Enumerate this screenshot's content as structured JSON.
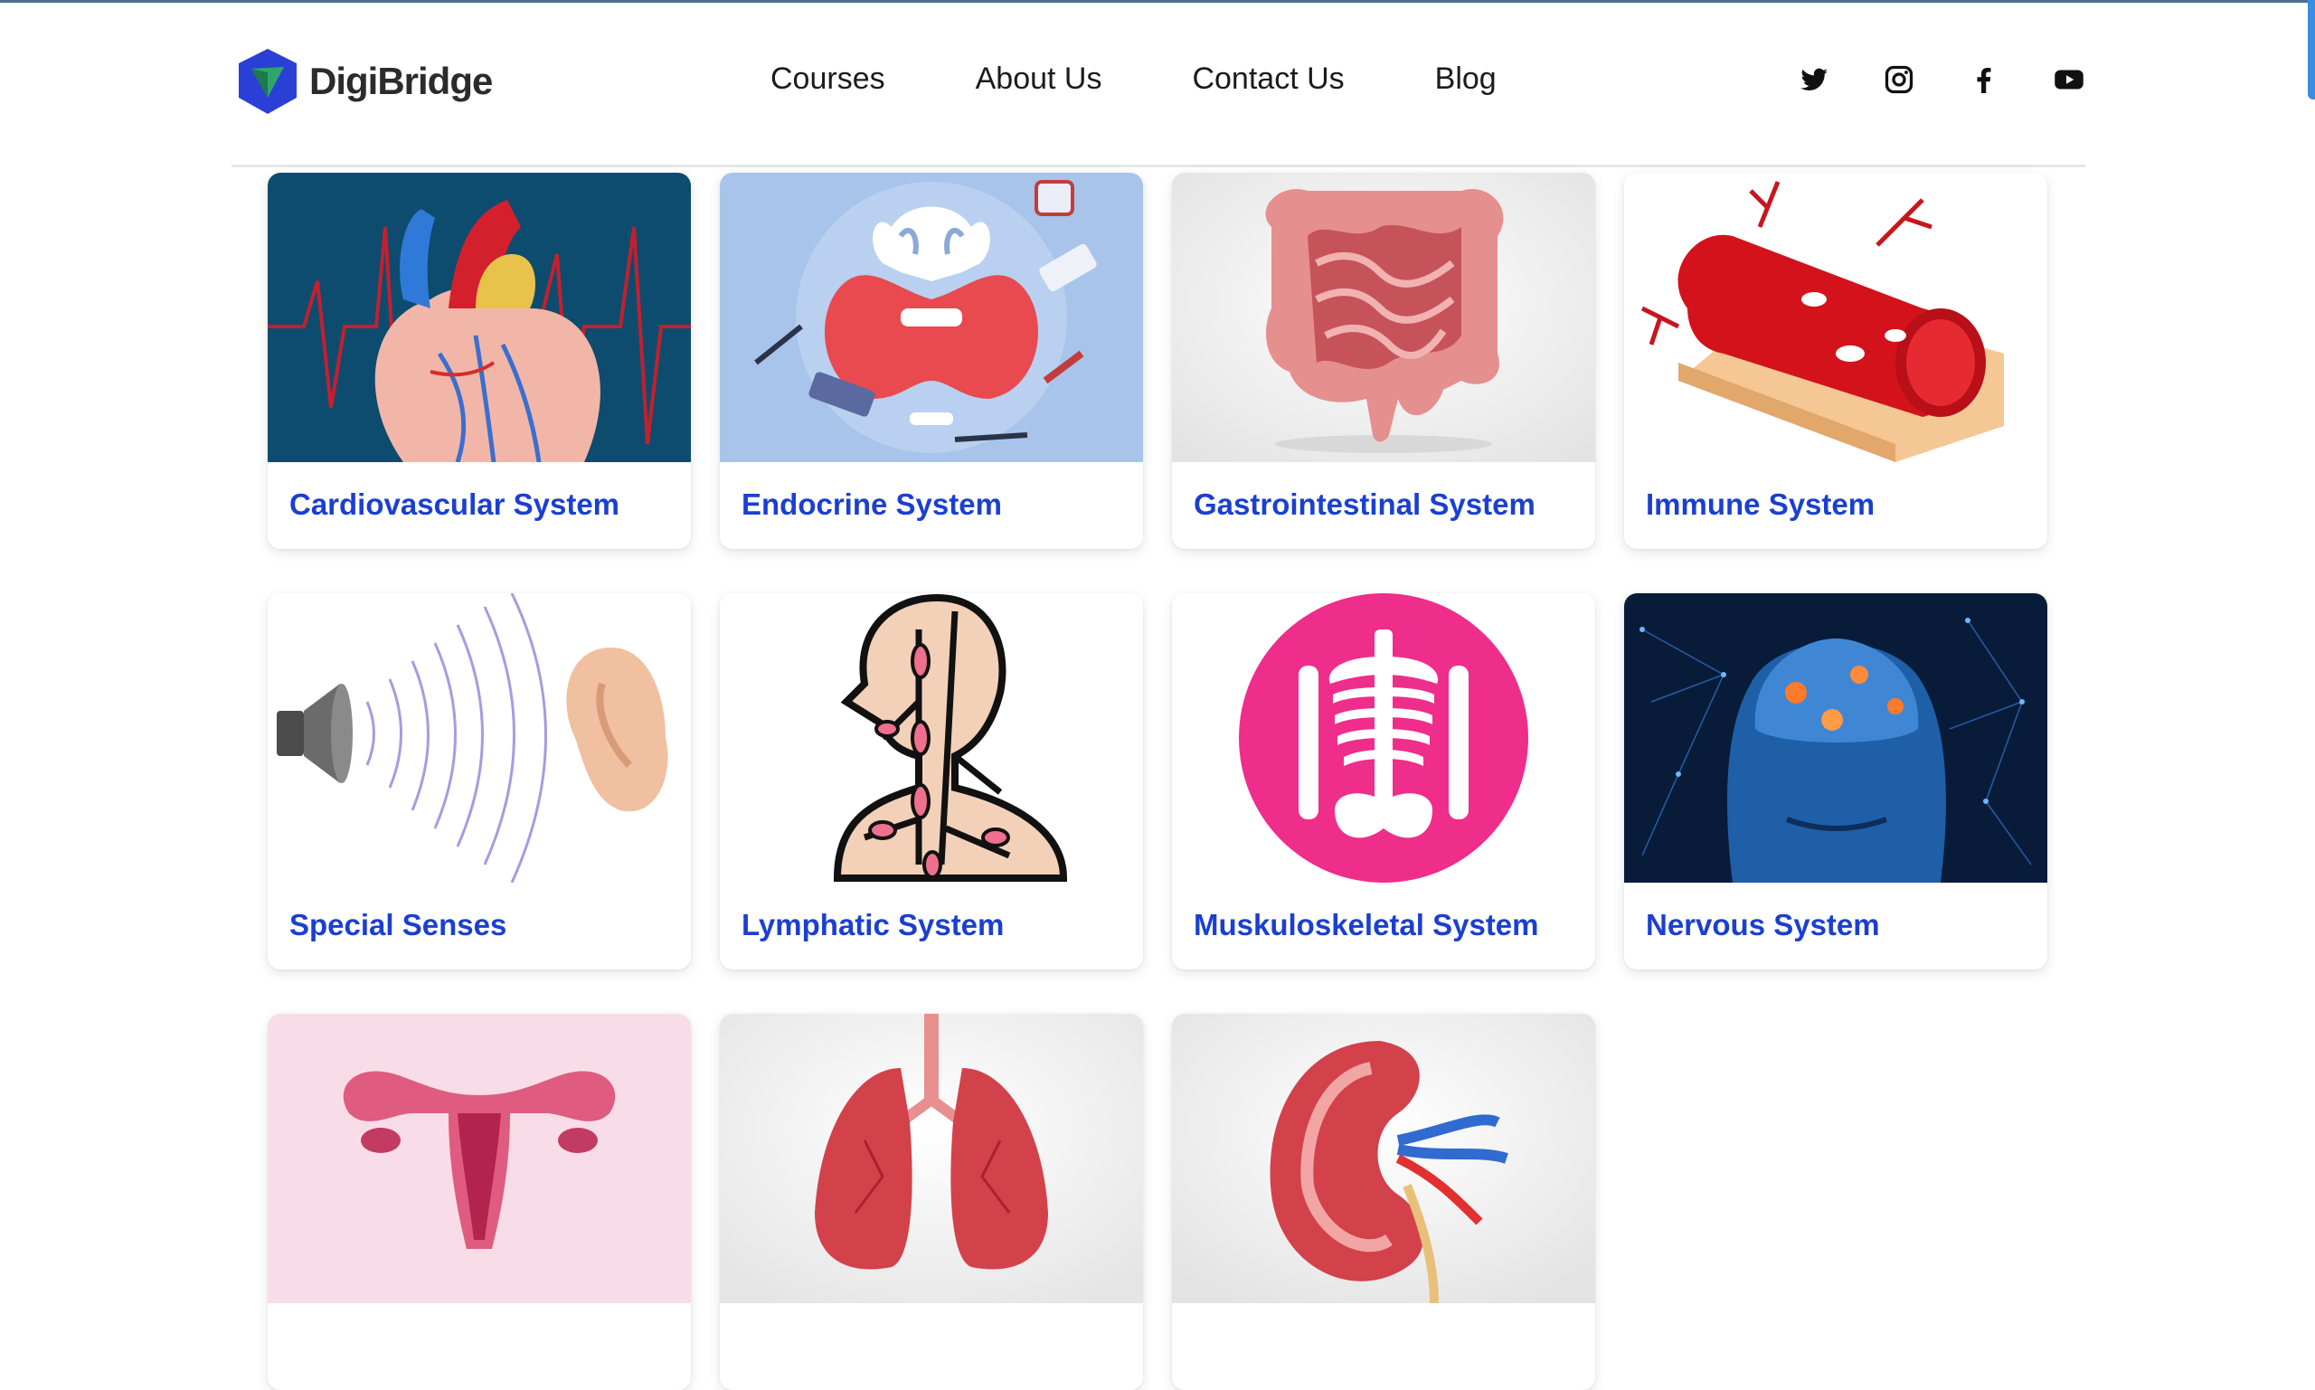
{
  "brand": {
    "name": "DigiBridge"
  },
  "nav": {
    "items": [
      "Courses",
      "About Us",
      "Contact Us",
      "Blog"
    ]
  },
  "social": [
    "twitter-icon",
    "instagram-icon",
    "facebook-icon",
    "youtube-icon"
  ],
  "colors": {
    "title": "#1b3fd1",
    "brand_blue": "#2a3fd6",
    "brand_green": "#2ea66b"
  },
  "cards": [
    {
      "title": "Cardiovascular System",
      "image": "heart-illustration"
    },
    {
      "title": "Endocrine System",
      "image": "thyroid-illustration"
    },
    {
      "title": "Gastrointestinal System",
      "image": "intestines-illustration"
    },
    {
      "title": "Immune System",
      "image": "blood-vessel-illustration"
    },
    {
      "title": "Special Senses",
      "image": "ear-sound-illustration"
    },
    {
      "title": "Lymphatic System",
      "image": "lymphatic-illustration"
    },
    {
      "title": "Muskuloskeletal System",
      "image": "skeleton-illustration"
    },
    {
      "title": "Nervous System",
      "image": "brain-illustration"
    },
    {
      "title": "",
      "image": "uterus-illustration"
    },
    {
      "title": "",
      "image": "lungs-illustration"
    },
    {
      "title": "",
      "image": "kidney-illustration"
    }
  ]
}
